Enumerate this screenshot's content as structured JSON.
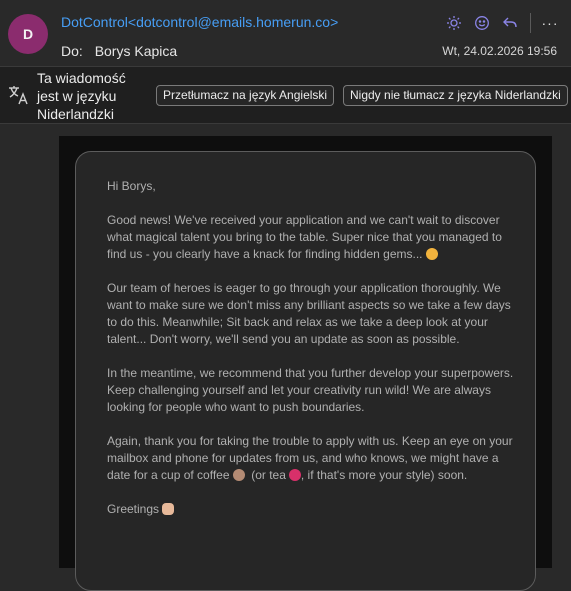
{
  "header": {
    "avatar_initial": "D",
    "from": "DotControl<dotcontrol@emails.homerun.co>",
    "to_label": "Do:",
    "to_name": "Borys Kapica",
    "date": "Wt, 24.02.2026 19:56",
    "actions": [
      "sun-icon",
      "smiley-icon",
      "reply-icon",
      "more-icon"
    ],
    "more_label": "···"
  },
  "translation": {
    "notice": "Ta wiadomość jest w języku Niderlandzki",
    "translate_button": "Przetłumacz na język Angielski",
    "never_button": "Nigdy nie tłumacz z języka Niderlandzki"
  },
  "email": {
    "greeting": "Hi Borys,",
    "p1": "Good news! We've received your application and we can't wait to discover what magical talent you bring to the table. Super nice that you managed to find us - you clearly have a knack for finding hidden gems...",
    "p2": "Our team of heroes is eager to go through your application thoroughly. We want to make sure we don't miss any brilliant aspects so we take a few days to do this. Meanwhile; Sit back and relax as we take a deep look at your talent... Don't worry, we'll send you an update as soon as possible.",
    "p3": "In the meantime, we recommend that you further develop your superpowers. Keep challenging yourself and let your creativity run wild! We are always looking for people who want to push boundaries.",
    "p4_a": "Again, thank you for taking the trouble to apply with us. Keep an eye on your mailbox and phone for updates from us, and who knows, we might have a date for a cup of coffee",
    "p4_b": "(or tea",
    "p4_c": ", if that's more your style) soon.",
    "closing": "Greetings"
  },
  "colors": {
    "accent": "#479ef5",
    "avatar": "#8b2c6e",
    "action_icons": "#8a84e6"
  }
}
